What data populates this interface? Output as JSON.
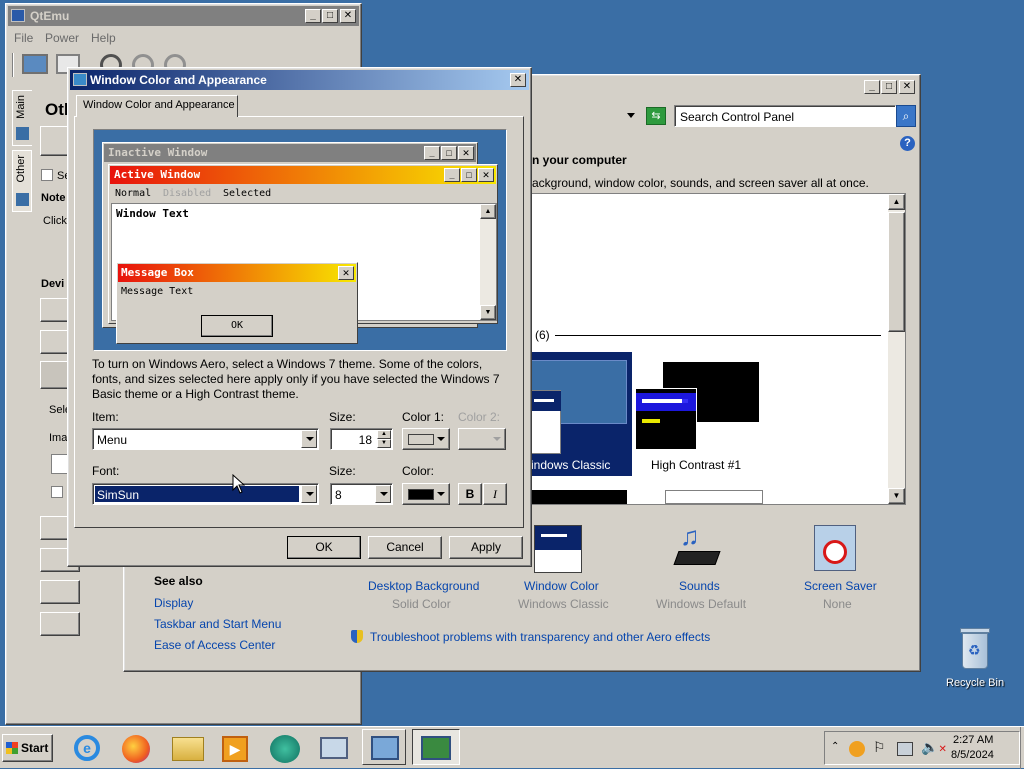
{
  "qtemu": {
    "title": "QtEmu",
    "menu": [
      "File",
      "Power",
      "Help"
    ],
    "side_tabs": [
      "Main",
      "Other"
    ],
    "heading": "Oth",
    "checkbox_label": "Se",
    "notes_label": "Note",
    "notes_text": "Click",
    "devices_label": "Devi",
    "select_label": "Sele",
    "image_label": "Ima"
  },
  "control_panel": {
    "search_placeholder": "Search Control Panel",
    "heading": "n your computer",
    "description": "ackground, window color, sounds, and screen saver all at once.",
    "basic_group": "(6)",
    "themes": [
      {
        "label": "indows Classic"
      },
      {
        "label": "High Contrast #1"
      }
    ],
    "see_also": {
      "title": "See also",
      "links": [
        "Display",
        "Taskbar and Start Menu",
        "Ease of Access Center"
      ]
    },
    "bottom_items": [
      {
        "label": "Desktop Background",
        "sub": "Solid Color"
      },
      {
        "label": "Window Color",
        "sub": "Windows Classic"
      },
      {
        "label": "Sounds",
        "sub": "Windows Default"
      },
      {
        "label": "Screen Saver",
        "sub": "None"
      }
    ],
    "troubleshoot": "Troubleshoot problems with transparency and other Aero effects"
  },
  "dialog": {
    "title": "Window Color and Appearance",
    "tab": "Window Color and Appearance",
    "preview": {
      "inactive_title": "Inactive Window",
      "active_title": "Active Window",
      "menu_normal": "Normal",
      "menu_disabled": "Disabled",
      "menu_selected": "Selected",
      "window_text": "Window Text",
      "msgbox_title": "Message Box",
      "msgbox_text": "Message Text",
      "msgbox_ok": "OK"
    },
    "info_text": "To turn on Windows Aero, select a Windows 7 theme.  Some of the colors, fonts, and sizes selected here apply only if you have selected the Windows 7 Basic theme or a High Contrast theme.",
    "item_label": "Item:",
    "item_value": "Menu",
    "size_label": "Size:",
    "size_value": "18",
    "color1_label": "Color 1:",
    "color2_label": "Color 2:",
    "font_label": "Font:",
    "font_value": "SimSun",
    "font_size_label": "Size:",
    "font_size_value": "8",
    "font_color_label": "Color:",
    "bold_label": "B",
    "italic_label": "I",
    "ok": "OK",
    "cancel": "Cancel",
    "apply": "Apply"
  },
  "desktop": {
    "recycle_bin": "Recycle Bin"
  },
  "taskbar": {
    "start": "Start",
    "time": "2:27 AM",
    "date": "8/5/2024"
  },
  "colors": {
    "desktop": "#3a6ea5",
    "active_title_start": "#e8120c",
    "active_title_end": "#f8e800",
    "selection": "#0a246a",
    "link": "#0645ad"
  }
}
